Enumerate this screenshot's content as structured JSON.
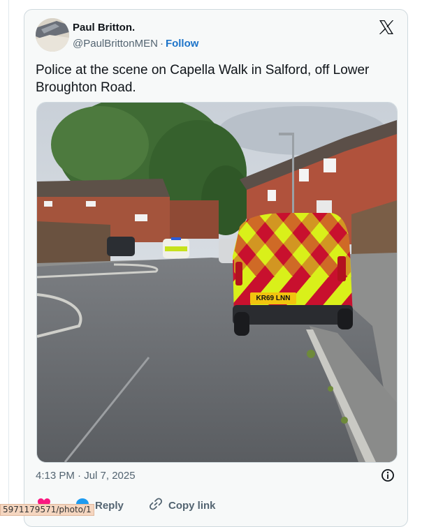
{
  "tweet": {
    "author_name": "Paul Britton.",
    "handle": "@PaulBrittonMEN",
    "separator": "·",
    "follow_label": "Follow",
    "text": "Police at the scene on Capella Walk in Salford, off Lower Broughton Road.",
    "timestamp": "4:13 PM · Jul 7, 2025",
    "media": {
      "plate": "KR69 LNN"
    }
  },
  "actions": {
    "reply_label": "Reply",
    "copy_link_label": "Copy link"
  },
  "status_bar": {
    "url": "5971179571/photo/1"
  },
  "icons": [
    "avatar",
    "x-logo-icon",
    "info-icon",
    "heart-icon",
    "reply-icon",
    "link-icon"
  ],
  "colors": {
    "follow": "#1d74c9",
    "muted": "#536471",
    "heart": "#f91880",
    "reply": "#1d9bf0"
  }
}
